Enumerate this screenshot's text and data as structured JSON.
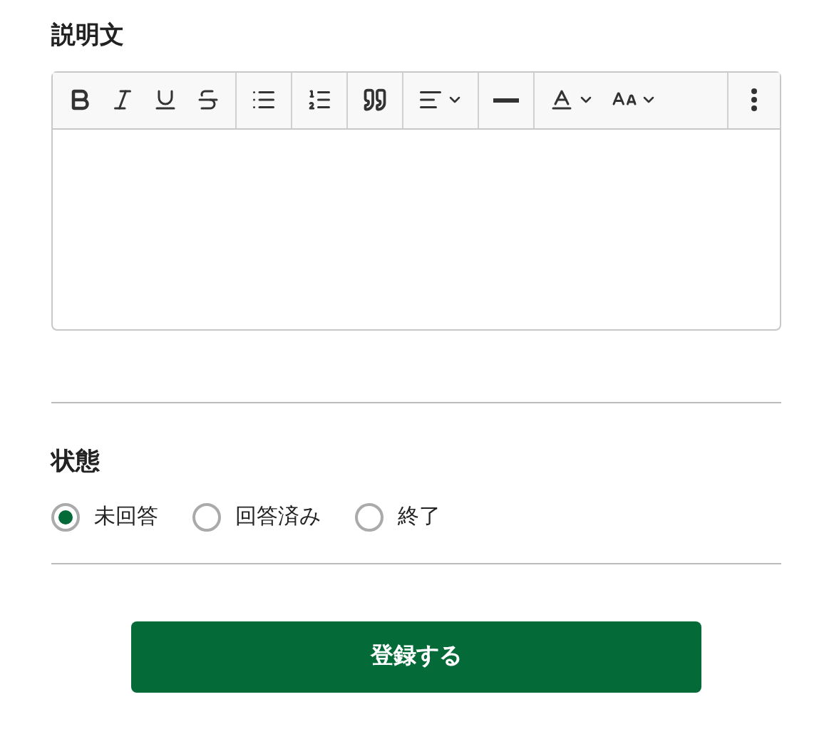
{
  "description": {
    "label": "説明文",
    "toolbar": [
      {
        "kind": "bold"
      },
      {
        "kind": "italic"
      },
      {
        "kind": "underline"
      },
      {
        "kind": "strike"
      },
      {
        "kind": "bullets"
      },
      {
        "kind": "numbers"
      },
      {
        "kind": "quote"
      },
      {
        "kind": "align"
      },
      {
        "kind": "rule"
      },
      {
        "kind": "color"
      },
      {
        "kind": "size"
      },
      {
        "kind": "more"
      }
    ]
  },
  "status": {
    "label": "状態",
    "options": [
      {
        "label": "未回答",
        "selected": true
      },
      {
        "label": "回答済み",
        "selected": false
      },
      {
        "label": "終了",
        "selected": false
      }
    ]
  },
  "submit": {
    "label": "登録する"
  }
}
